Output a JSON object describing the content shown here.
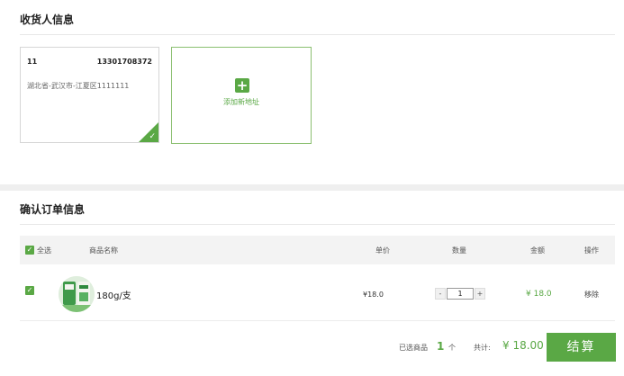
{
  "receiver": {
    "title": "收货人信息",
    "address": {
      "name": "11",
      "phone": "13301708372",
      "location": "湖北省-武汉市-江夏区1111111"
    },
    "add_label": "添加新地址"
  },
  "order": {
    "title": "确认订单信息",
    "columns": {
      "select_all": "全选",
      "name": "商品名称",
      "price": "单价",
      "qty": "数量",
      "amount": "金额",
      "action": "操作"
    },
    "items": [
      {
        "name": "180g/支",
        "price": "¥18.0",
        "qty": "1",
        "minus": "-",
        "plus": "+",
        "amount": "¥ 18.0",
        "remove": "移除"
      }
    ],
    "summary": {
      "selected_prefix": "已选商品",
      "selected_count": "1",
      "selected_unit": "个",
      "total_label": "共计:",
      "total": "¥ 18.00",
      "checkout": "结算"
    }
  },
  "icons": {
    "checkbox": "check-icon",
    "add": "plus-icon",
    "selected_corner": "check-icon"
  },
  "colors": {
    "accent": "#5aa845",
    "accent_border": "#8bbf70"
  }
}
